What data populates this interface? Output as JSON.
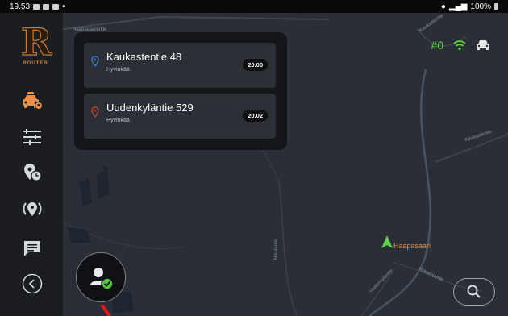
{
  "statusbar": {
    "time": "19.53",
    "battery": "100%",
    "dot": "•"
  },
  "app": {
    "logo_letter": "R",
    "logo_text": "ROUTER"
  },
  "sidebar": {
    "items": [
      {
        "icon": "taxi-icon",
        "active": true
      },
      {
        "icon": "sliders-icon"
      },
      {
        "icon": "location-clock-icon"
      },
      {
        "icon": "radar-pin-icon"
      },
      {
        "icon": "message-icon"
      },
      {
        "icon": "back-arrow-icon"
      }
    ]
  },
  "trip": {
    "pickup": {
      "address": "Kaukastentie 48",
      "city": "Hyvinkää",
      "time": "20.00"
    },
    "dropoff": {
      "address": "Uudenkyläntie 529",
      "city": "Hyvinkää",
      "time": "20.02"
    }
  },
  "status": {
    "queue": "#0"
  },
  "map": {
    "labels": {
      "road1": "Haapasaarentie",
      "road2": "Kaukastentie",
      "road3": "Kaukastentie",
      "road4": "Nikulantie",
      "road5": "Uudenkyläntie",
      "road6": "Niikarojantie",
      "place": "Haapasaari"
    }
  },
  "colors": {
    "accent": "#e8904a",
    "green": "#5fd24a",
    "pickup_pin": "#3e7bd6",
    "dropoff_pin": "#c9442f"
  }
}
